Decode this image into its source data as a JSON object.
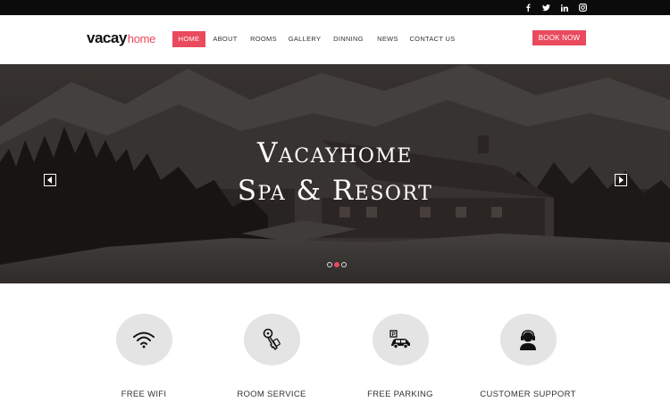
{
  "brand": {
    "logo_main": "vacay",
    "logo_accent": "home"
  },
  "social": [
    "facebook-icon",
    "twitter-icon",
    "linkedin-icon",
    "instagram-icon"
  ],
  "nav": {
    "items": [
      {
        "label": "HOME",
        "active": true
      },
      {
        "label": "ABOUT"
      },
      {
        "label": "ROOMS"
      },
      {
        "label": "GALLERY"
      },
      {
        "label": "DINNING"
      },
      {
        "label": "NEWS"
      },
      {
        "label": "CONTACT US"
      }
    ],
    "cta": "BOOK NOW"
  },
  "hero": {
    "line1": "Vacayhome",
    "line2": "Spa & Resort",
    "slides": 3,
    "active_slide": 2
  },
  "features": [
    {
      "label": "FREE WIFI",
      "icon": "wifi-icon"
    },
    {
      "label": "ROOM SERVICE",
      "icon": "key-icon"
    },
    {
      "label": "FREE PARKING",
      "icon": "parking-car-icon"
    },
    {
      "label": "CUSTOMER SUPPORT",
      "icon": "support-agent-icon"
    }
  ],
  "colors": {
    "accent": "#ea4a5e",
    "topbar": "#0b0b0b",
    "circle": "#e4e4e4"
  }
}
